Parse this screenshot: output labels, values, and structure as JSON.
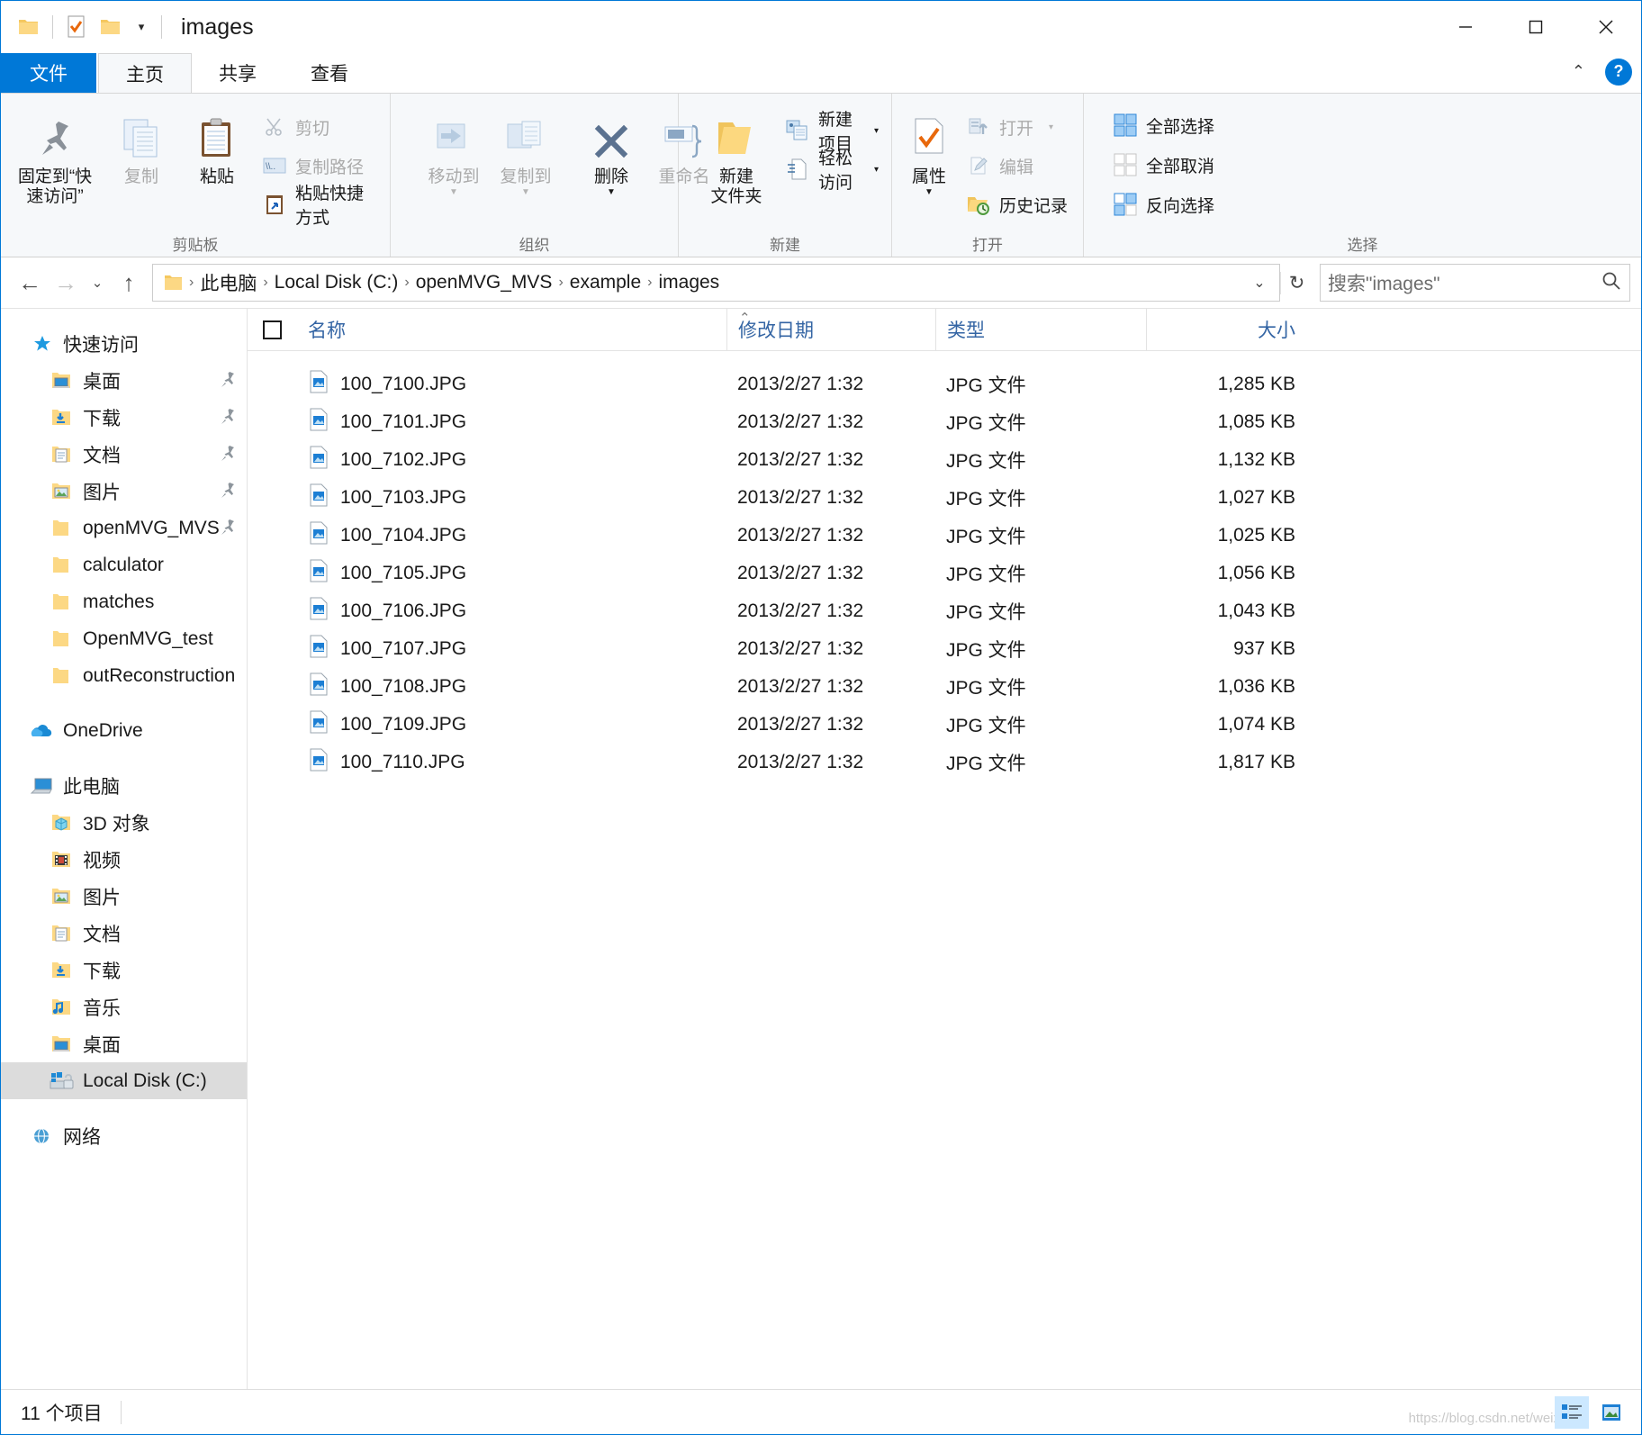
{
  "window": {
    "title": "images",
    "quick_access": [
      "folder-icon",
      "save-icon",
      "new-folder-icon"
    ],
    "controls": {
      "minimize": "minimize-icon",
      "maximize": "maximize-icon",
      "close": "close-icon"
    }
  },
  "tabs": [
    {
      "label": "文件",
      "name": "tab-file",
      "state": "file"
    },
    {
      "label": "主页",
      "name": "tab-home",
      "state": "active"
    },
    {
      "label": "共享",
      "name": "tab-share",
      "state": "normal"
    },
    {
      "label": "查看",
      "name": "tab-view",
      "state": "normal"
    }
  ],
  "help": {
    "label": "?"
  },
  "ribbon": {
    "groups": [
      {
        "label": "剪贴板",
        "big": [
          {
            "label": "固定到“快\n速访问”",
            "icon": "pin-icon",
            "disabled": false
          },
          {
            "label": "复制",
            "icon": "copy-icon",
            "disabled": true
          },
          {
            "label": "粘贴",
            "icon": "paste-icon",
            "disabled": false
          }
        ],
        "small": [
          {
            "label": "剪切",
            "icon": "scissors-icon",
            "disabled": true
          },
          {
            "label": "复制路径",
            "icon": "copy-path-icon",
            "disabled": true
          },
          {
            "label": "粘贴快捷方式",
            "icon": "paste-shortcut-icon",
            "disabled": false
          }
        ]
      },
      {
        "label": "组织",
        "big": [
          {
            "label": "移动到",
            "icon": "move-to-icon",
            "disabled": true,
            "caret": true
          },
          {
            "label": "复制到",
            "icon": "copy-to-icon",
            "disabled": true,
            "caret": true
          },
          {
            "label": "删除",
            "icon": "delete-icon",
            "disabled": false,
            "caret": true
          },
          {
            "label": "重命名",
            "icon": "rename-icon",
            "disabled": true
          }
        ],
        "small": []
      },
      {
        "label": "新建",
        "big": [
          {
            "label": "新建\n文件夹",
            "icon": "new-folder-icon",
            "disabled": false
          }
        ],
        "small": [
          {
            "label": "新建项目",
            "icon": "new-item-icon",
            "disabled": false,
            "caret": true
          },
          {
            "label": "轻松访问",
            "icon": "easy-access-icon",
            "disabled": false,
            "caret": true
          }
        ]
      },
      {
        "label": "打开",
        "big": [
          {
            "label": "属性",
            "icon": "properties-icon",
            "disabled": false,
            "caret": true
          }
        ],
        "small": [
          {
            "label": "打开",
            "icon": "open-icon",
            "disabled": true,
            "caret": true
          },
          {
            "label": "编辑",
            "icon": "edit-icon",
            "disabled": true
          },
          {
            "label": "历史记录",
            "icon": "history-icon",
            "disabled": false
          }
        ]
      },
      {
        "label": "选择",
        "big": [],
        "small": [
          {
            "label": "全部选择",
            "icon": "select-all-icon",
            "disabled": false
          },
          {
            "label": "全部取消",
            "icon": "select-none-icon",
            "disabled": false
          },
          {
            "label": "反向选择",
            "icon": "invert-selection-icon",
            "disabled": false
          }
        ]
      }
    ]
  },
  "address": {
    "back": "back-arrow-icon",
    "forward": "forward-arrow-icon",
    "recent": "chevron-down-icon",
    "up": "up-arrow-icon",
    "crumbs": [
      "此电脑",
      "Local Disk (C:)",
      "openMVG_MVS",
      "example",
      "images"
    ],
    "dropdown": "chevron-down-icon",
    "refresh": "refresh-icon"
  },
  "search": {
    "placeholder": "搜索\"images\"",
    "icon": "search-icon"
  },
  "sidebar": {
    "items": [
      {
        "label": "快速访问",
        "icon": "star-icon",
        "level": 0,
        "pinned": false,
        "selected": false
      },
      {
        "label": "桌面",
        "icon": "desktop-folder-icon",
        "level": 1,
        "pinned": true,
        "selected": false
      },
      {
        "label": "下载",
        "icon": "downloads-folder-icon",
        "level": 1,
        "pinned": true,
        "selected": false
      },
      {
        "label": "文档",
        "icon": "documents-folder-icon",
        "level": 1,
        "pinned": true,
        "selected": false
      },
      {
        "label": "图片",
        "icon": "pictures-folder-icon",
        "level": 1,
        "pinned": true,
        "selected": false
      },
      {
        "label": "openMVG_MVS",
        "icon": "folder-icon",
        "level": 1,
        "pinned": true,
        "selected": false
      },
      {
        "label": "calculator",
        "icon": "folder-icon",
        "level": 1,
        "pinned": false,
        "selected": false
      },
      {
        "label": "matches",
        "icon": "folder-icon",
        "level": 1,
        "pinned": false,
        "selected": false
      },
      {
        "label": "OpenMVG_test",
        "icon": "folder-icon",
        "level": 1,
        "pinned": false,
        "selected": false
      },
      {
        "label": "outReconstruction",
        "icon": "folder-icon",
        "level": 1,
        "pinned": false,
        "selected": false
      },
      {
        "label": "__GAP__",
        "icon": "",
        "level": 0,
        "pinned": false,
        "selected": false
      },
      {
        "label": "OneDrive",
        "icon": "onedrive-icon",
        "level": 0,
        "pinned": false,
        "selected": false
      },
      {
        "label": "__GAP__",
        "icon": "",
        "level": 0,
        "pinned": false,
        "selected": false
      },
      {
        "label": "此电脑",
        "icon": "this-pc-icon",
        "level": 0,
        "pinned": false,
        "selected": false
      },
      {
        "label": "3D 对象",
        "icon": "3d-objects-folder-icon",
        "level": 1,
        "pinned": false,
        "selected": false
      },
      {
        "label": "视频",
        "icon": "videos-folder-icon",
        "level": 1,
        "pinned": false,
        "selected": false
      },
      {
        "label": "图片",
        "icon": "pictures-folder-icon",
        "level": 1,
        "pinned": false,
        "selected": false
      },
      {
        "label": "文档",
        "icon": "documents-folder-icon",
        "level": 1,
        "pinned": false,
        "selected": false
      },
      {
        "label": "下载",
        "icon": "downloads-folder-icon",
        "level": 1,
        "pinned": false,
        "selected": false
      },
      {
        "label": "音乐",
        "icon": "music-folder-icon",
        "level": 1,
        "pinned": false,
        "selected": false
      },
      {
        "label": "桌面",
        "icon": "desktop-folder-icon",
        "level": 1,
        "pinned": false,
        "selected": false
      },
      {
        "label": "Local Disk (C:)",
        "icon": "local-disk-icon",
        "level": 1,
        "pinned": false,
        "selected": true
      },
      {
        "label": "__GAP__",
        "icon": "",
        "level": 0,
        "pinned": false,
        "selected": false
      },
      {
        "label": "网络",
        "icon": "network-icon",
        "level": 0,
        "pinned": false,
        "selected": false
      }
    ]
  },
  "filelist": {
    "columns": [
      "名称",
      "修改日期",
      "类型",
      "大小"
    ],
    "sorted_column": "名称",
    "sort_direction": "asc",
    "rows": [
      {
        "name": "100_7100.JPG",
        "date": "2013/2/27 1:32",
        "type": "JPG 文件",
        "size": "1,285 KB"
      },
      {
        "name": "100_7101.JPG",
        "date": "2013/2/27 1:32",
        "type": "JPG 文件",
        "size": "1,085 KB"
      },
      {
        "name": "100_7102.JPG",
        "date": "2013/2/27 1:32",
        "type": "JPG 文件",
        "size": "1,132 KB"
      },
      {
        "name": "100_7103.JPG",
        "date": "2013/2/27 1:32",
        "type": "JPG 文件",
        "size": "1,027 KB"
      },
      {
        "name": "100_7104.JPG",
        "date": "2013/2/27 1:32",
        "type": "JPG 文件",
        "size": "1,025 KB"
      },
      {
        "name": "100_7105.JPG",
        "date": "2013/2/27 1:32",
        "type": "JPG 文件",
        "size": "1,056 KB"
      },
      {
        "name": "100_7106.JPG",
        "date": "2013/2/27 1:32",
        "type": "JPG 文件",
        "size": "1,043 KB"
      },
      {
        "name": "100_7107.JPG",
        "date": "2013/2/27 1:32",
        "type": "JPG 文件",
        "size": "937 KB"
      },
      {
        "name": "100_7108.JPG",
        "date": "2013/2/27 1:32",
        "type": "JPG 文件",
        "size": "1,036 KB"
      },
      {
        "name": "100_7109.JPG",
        "date": "2013/2/27 1:32",
        "type": "JPG 文件",
        "size": "1,074 KB"
      },
      {
        "name": "100_7110.JPG",
        "date": "2013/2/27 1:32",
        "type": "JPG 文件",
        "size": "1,817 KB"
      }
    ]
  },
  "statusbar": {
    "item_count": "11 个项目",
    "view_details": "details-view-icon",
    "view_large": "large-icons-view-icon",
    "watermark": "https://blog.csdn.net/weix"
  },
  "colors": {
    "accent": "#0078d7",
    "column_header": "#3465a4",
    "folder": "#ffd271",
    "selection": "#dcdcdc"
  }
}
